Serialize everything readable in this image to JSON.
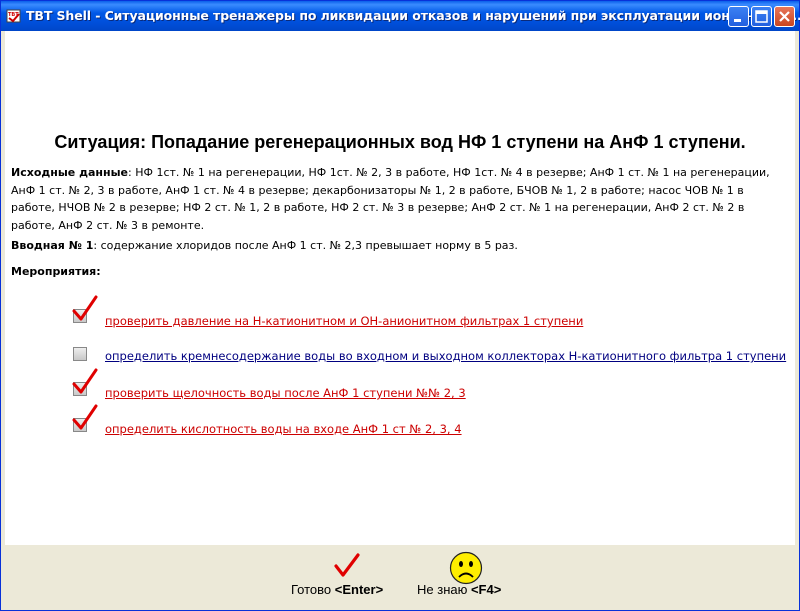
{
  "window": {
    "title": "TBT Shell - Ситуационные тренажеры по ликвидации отказов и нарушений при эксплуатации ионитной ча...",
    "icon": "app-icon",
    "buttons": [
      "minimize",
      "maximize",
      "close"
    ]
  },
  "situation": {
    "heading": "Ситуация: Попадание регенерационных вод НФ 1 ступени на АнФ 1 ступени.",
    "initial_label": "Исходные данные",
    "initial_text": ": НФ 1ст. № 1 на регенерации, НФ 1ст. № 2, 3 в работе, НФ 1ст. № 4 в резерве; АнФ 1 ст. № 1 на регенерации, АнФ 1 ст. № 2, 3 в работе, АнФ 1 ст. № 4 в резерве; декарбонизаторы № 1, 2 в работе, БЧОВ № 1, 2 в работе; насос ЧОВ № 1 в работе, НЧОВ № 2 в резерве; НФ 2 ст. № 1, 2 в работе, НФ 2 ст. № 3 в резерве; АнФ 2 ст. № 1 на регенерации, АнФ 2 ст. № 2 в работе, АнФ 2 ст. № 3 в ремонте.",
    "intro_label": "Вводная № 1",
    "intro_text": ": содержание хлоридов после АнФ 1 ст. № 2,3 превышает норму в 5 раз.",
    "measures_label": "Мероприятия:"
  },
  "items": [
    {
      "label": "проверить давление на Н-катионитном и ОН-анионитном фильтрах 1 ступени",
      "checked": true,
      "color": "#CC0000"
    },
    {
      "label": "определить кремнесодержание воды во входном и выходном коллекторах Н-катионитного фильтра 1 ступени",
      "checked": false,
      "color": "#000080"
    },
    {
      "label": "проверить щелочность воды после АнФ 1 ступени №№ 2, 3",
      "checked": true,
      "color": "#CC0000"
    },
    {
      "label": "определить кислотность воды на входе АнФ 1 ст № 2, 3, 4",
      "checked": true,
      "color": "#CC0000"
    }
  ],
  "footer": {
    "ready_label": "Готово ",
    "ready_key": "<Enter>",
    "ready_icon": "red-check-icon",
    "dontknow_label": "Не знаю ",
    "dontknow_key": "<F4>",
    "dontknow_icon": "sad-smiley-icon"
  }
}
